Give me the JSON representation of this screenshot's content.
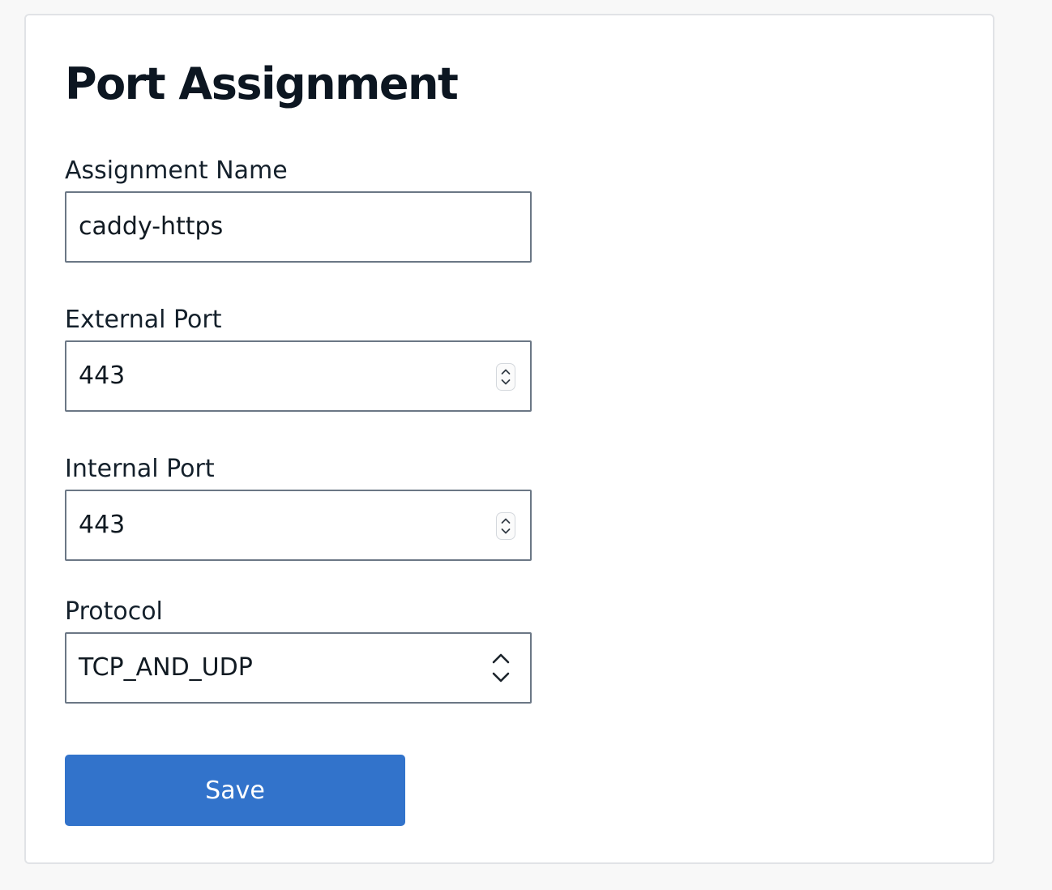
{
  "form": {
    "title": "Port Assignment",
    "assignment_name": {
      "label": "Assignment Name",
      "value": "caddy-https"
    },
    "external_port": {
      "label": "External Port",
      "value": "443"
    },
    "internal_port": {
      "label": "Internal Port",
      "value": "443"
    },
    "protocol": {
      "label": "Protocol",
      "value": "TCP_AND_UDP"
    },
    "save_label": "Save"
  },
  "colors": {
    "page_background": "#f8f8f8",
    "card_background": "#ffffff",
    "card_border": "#e1e3e6",
    "field_border": "#6b7785",
    "text": "#0f1a24",
    "primary_button": "#3273cb",
    "primary_button_text": "#ffffff"
  },
  "icons": {
    "number_stepper": "up-down-stepper-icon",
    "select_toggle": "chevron-up-down-icon"
  }
}
